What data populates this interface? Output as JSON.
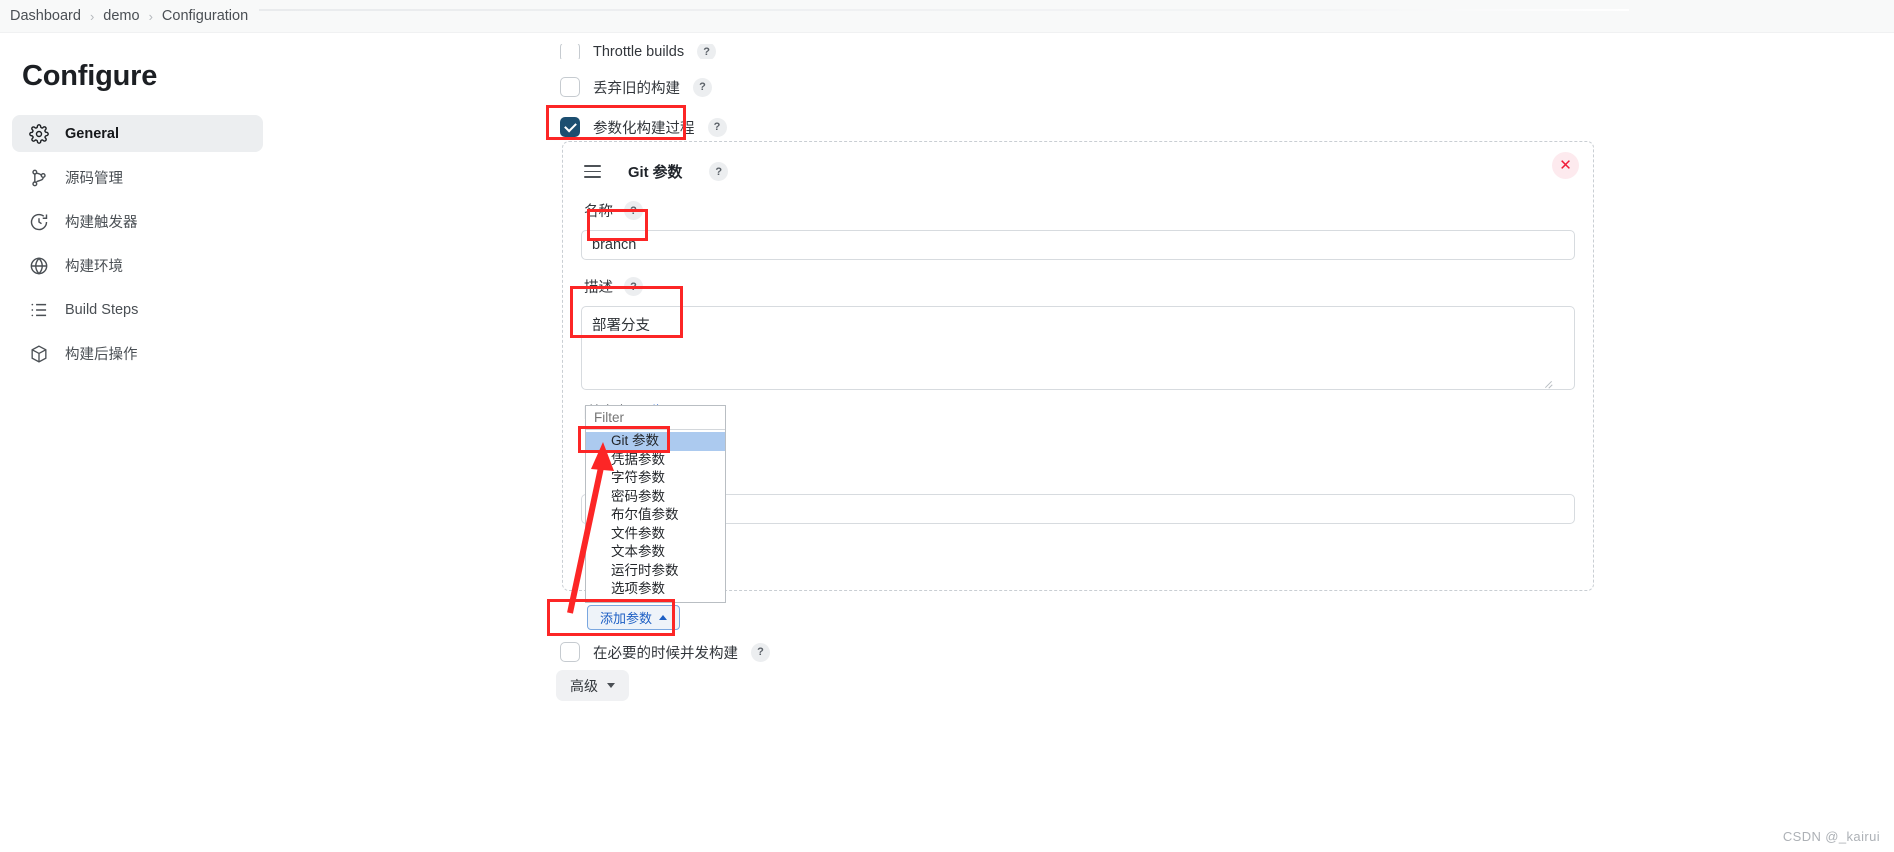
{
  "breadcrumb": {
    "items": [
      "Dashboard",
      "demo",
      "Configuration"
    ],
    "separator": "›"
  },
  "sidebar": {
    "title": "Configure",
    "items": [
      {
        "label": "General",
        "icon": "gear-icon",
        "active": true
      },
      {
        "label": "源码管理",
        "icon": "branch-icon",
        "active": false
      },
      {
        "label": "构建触发器",
        "icon": "clock-icon",
        "active": false
      },
      {
        "label": "构建环境",
        "icon": "globe-icon",
        "active": false
      },
      {
        "label": "Build Steps",
        "icon": "list-icon",
        "active": false
      },
      {
        "label": "构建后操作",
        "icon": "package-icon",
        "active": false
      }
    ]
  },
  "main": {
    "checkboxes": [
      {
        "label": "Throttle builds",
        "checked": false,
        "help": "?"
      },
      {
        "label": "丢弃旧的构建",
        "checked": false,
        "help": "?"
      },
      {
        "label": "参数化构建过程",
        "checked": true,
        "help": "?"
      }
    ],
    "bottom_checkbox": {
      "label": "在必要的时候并发构建",
      "checked": false,
      "help": "?"
    },
    "advanced_button": "高级",
    "param_panel": {
      "title": "Git 参数",
      "help": "?",
      "close_label": "✕",
      "name_field": {
        "label": "名称",
        "help": "?",
        "value": "branch",
        "placeholder": ""
      },
      "description_field": {
        "label": "描述",
        "help": "?",
        "value": "部署分支",
        "placeholder": ""
      },
      "plain_text_note": "[纯文本]",
      "preview_link": "预览"
    },
    "dropdown": {
      "filter_placeholder": "Filter",
      "filter_value": "",
      "items": [
        {
          "label": "Git 参数",
          "selected": true
        },
        {
          "label": "凭据参数",
          "selected": false
        },
        {
          "label": "字符参数",
          "selected": false
        },
        {
          "label": "密码参数",
          "selected": false
        },
        {
          "label": "布尔值参数",
          "selected": false
        },
        {
          "label": "文件参数",
          "selected": false
        },
        {
          "label": "文本参数",
          "selected": false
        },
        {
          "label": "运行时参数",
          "selected": false
        },
        {
          "label": "选项参数",
          "selected": false
        }
      ]
    },
    "add_param_button": "添加参数"
  },
  "watermark": "CSDN @_kairui",
  "colors": {
    "highlight": "#fc2626",
    "accent_blue": "#1d5fc4",
    "checkbox_checked": "#1c4e70",
    "dropdown_selected": "#accaef",
    "link": "#2361d4"
  }
}
